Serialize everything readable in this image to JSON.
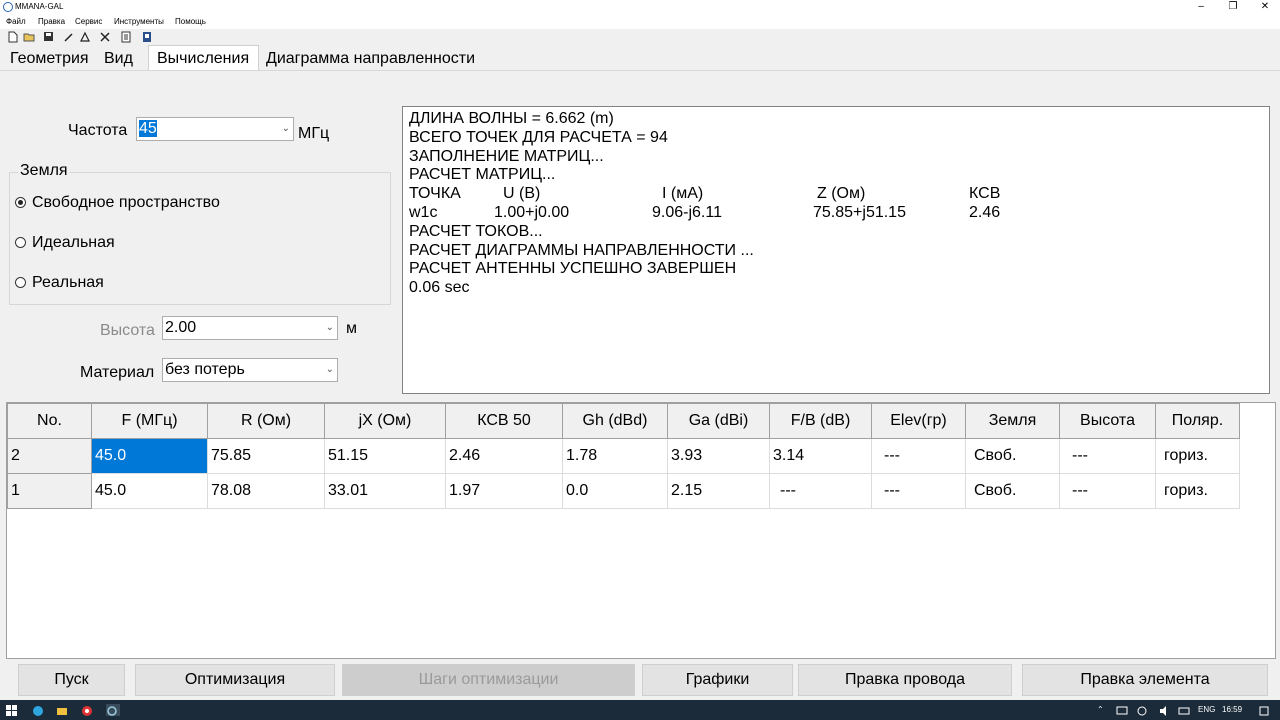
{
  "window": {
    "title": "MMANA-GAL",
    "minimize": "–",
    "maximize": "❐",
    "close": "✕"
  },
  "menu": [
    "Файл",
    "Правка",
    "Сервис",
    "Инструменты",
    "Помощь"
  ],
  "toolbar_icons": [
    "new-file-icon",
    "open-folder-icon",
    "save-icon",
    "pencil-icon",
    "triangle-icon",
    "tools-icon",
    "document-icon",
    "user-icon"
  ],
  "tabs": [
    {
      "label": "Геометрия",
      "active": false
    },
    {
      "label": "Вид",
      "active": false
    },
    {
      "label": "Вычисления",
      "active": true
    },
    {
      "label": "Диаграмма направленности",
      "active": false
    }
  ],
  "frequency": {
    "label": "Частота",
    "value": "45",
    "unit": "МГц"
  },
  "ground": {
    "legend": "Земля",
    "options": [
      {
        "label": "Свободное пространство",
        "selected": true
      },
      {
        "label": "Идеальная",
        "selected": false
      },
      {
        "label": "Реальная",
        "selected": false
      }
    ]
  },
  "height": {
    "label": "Высота",
    "value": "2.00",
    "unit": "м"
  },
  "material": {
    "label": "Материал",
    "value": "без потерь"
  },
  "output": {
    "lines": [
      "ДЛИНА ВОЛНЫ = 6.662 (m)",
      "ВСЕГО ТОЧЕК ДЛЯ РАСЧЕТА = 94",
      "ЗАПОЛНЕНИЕ МАТРИЦ...",
      "РАСЧЕТ МАТРИЦ..."
    ],
    "table_header": [
      "ТОЧКА",
      "U (В)",
      "I (мА)",
      "Z (Ом)",
      "КСВ"
    ],
    "table_row": [
      "w1c",
      "1.00+j0.00",
      "9.06-j6.11",
      "75.85+j51.15",
      "2.46"
    ],
    "lines_after": [
      "РАСЧЕТ ТОКОВ...",
      "РАСЧЕТ ДИАГРАММЫ НАПРАВЛЕННОСТИ ...",
      "РАСЧЕТ АНТЕННЫ УСПЕШНО ЗАВЕРШЕН",
      "0.06 sec"
    ]
  },
  "results": {
    "columns": [
      "No.",
      "F (МГц)",
      "R (Ом)",
      "jX (Ом)",
      "КСВ 50",
      "Gh (dBd)",
      "Ga (dBi)",
      "F/B (dB)",
      "Elev(гр)",
      "Земля",
      "Высота",
      "Поляр."
    ],
    "rows": [
      [
        "2",
        "45.0",
        "75.85",
        "51.15",
        "2.46",
        "1.78",
        "3.93",
        "3.14",
        "---",
        "Своб.",
        "---",
        "гориз."
      ],
      [
        "1",
        "45.0",
        "78.08",
        "33.01",
        "1.97",
        "0.0",
        "2.15",
        " ---",
        "---",
        "Своб.",
        "---",
        "гориз."
      ]
    ]
  },
  "buttons": [
    {
      "label": "Пуск",
      "enabled": true
    },
    {
      "label": "Оптимизация",
      "enabled": true
    },
    {
      "label": "Шаги оптимизации",
      "enabled": false
    },
    {
      "label": "Графики",
      "enabled": true
    },
    {
      "label": "Правка провода",
      "enabled": true
    },
    {
      "label": "Правка элемента",
      "enabled": true
    }
  ],
  "taskbar": {
    "language": "ENG",
    "time": "16:59"
  }
}
